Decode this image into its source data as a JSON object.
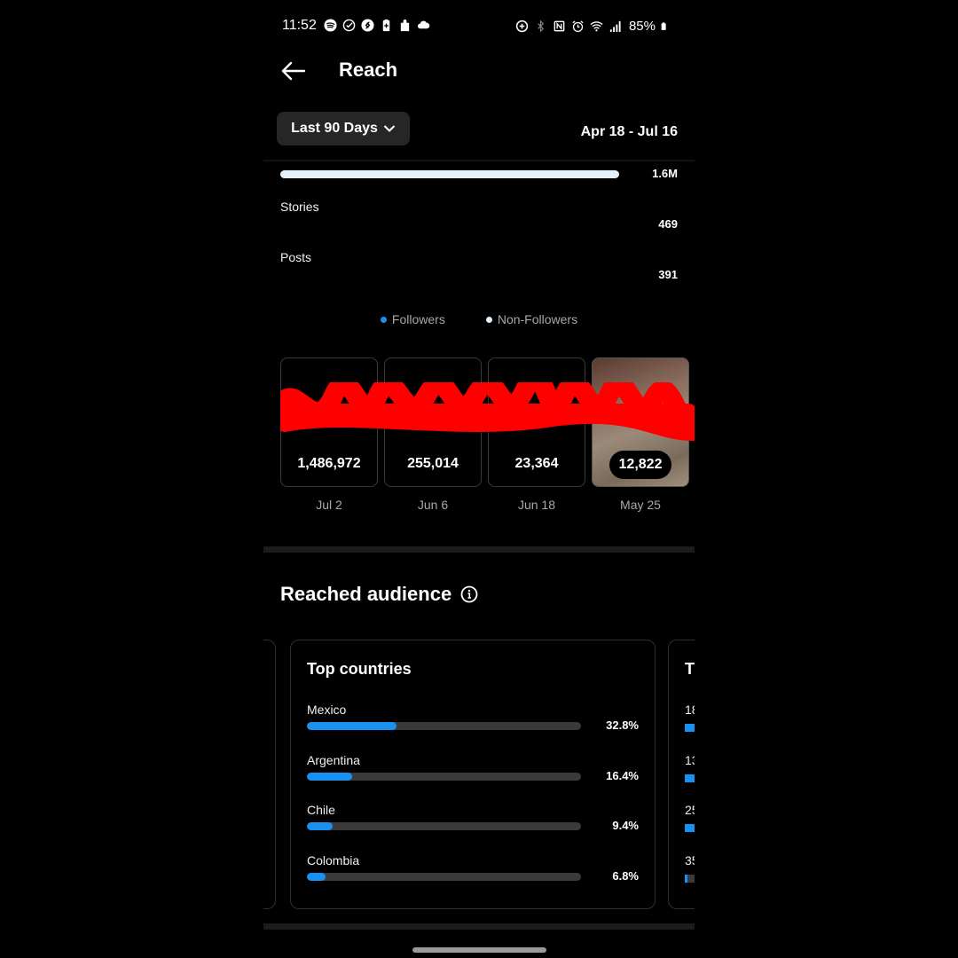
{
  "status_bar": {
    "time": "11:52",
    "left_icons": [
      "spotify-icon",
      "check-circle-icon",
      "shazam-icon",
      "battery-saver-icon",
      "puzzle-icon",
      "cloud-icon"
    ],
    "right_icons": [
      "data-saver-icon",
      "bluetooth-icon",
      "nfc-icon",
      "alarm-icon",
      "wifi-icon",
      "signal-icon"
    ],
    "battery": "85%"
  },
  "header": {
    "title": "Reach"
  },
  "filter": {
    "range_label": "Last 90 Days",
    "date_range": "Apr 18 - Jul 16"
  },
  "breakdown": {
    "total_value": "1.6M",
    "total_fraction": 1.0,
    "rows": [
      {
        "label": "Stories",
        "value": "469"
      },
      {
        "label": "Posts",
        "value": "391"
      }
    ]
  },
  "legend": [
    {
      "label": "Followers",
      "color": "#1a91f0"
    },
    {
      "label": "Non-Followers",
      "color": "#e6f2fb"
    }
  ],
  "top_content": [
    {
      "value": "1,486,972",
      "date": "Jul 2"
    },
    {
      "value": "255,014",
      "date": "Jun 6"
    },
    {
      "value": "23,364",
      "date": "Jun 18"
    },
    {
      "value": "12,822",
      "date": "May 25"
    }
  ],
  "reached_audience": {
    "title": "Reached audience",
    "top_countries": {
      "title": "Top countries",
      "items": [
        {
          "name": "Mexico",
          "percent_label": "32.8%",
          "percent": 32.8
        },
        {
          "name": "Argentina",
          "percent_label": "16.4%",
          "percent": 16.4
        },
        {
          "name": "Chile",
          "percent_label": "9.4%",
          "percent": 9.4
        },
        {
          "name": "Colombia",
          "percent_label": "6.8%",
          "percent": 6.8
        }
      ]
    },
    "next_card_peek": {
      "title": "T",
      "items": [
        "18",
        "13",
        "25",
        "35"
      ]
    }
  },
  "colors": {
    "accent": "#1a91f0",
    "track": "#3a3a3a",
    "redaction": "#ff0000"
  }
}
